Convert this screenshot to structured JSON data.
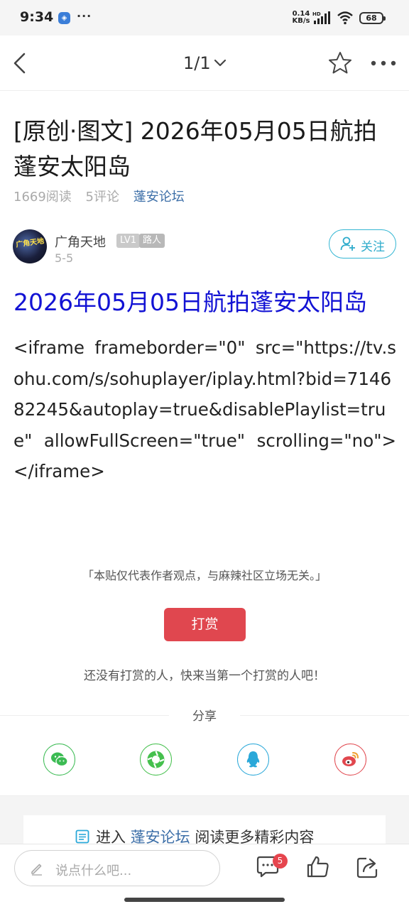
{
  "status_bar": {
    "time": "9:34",
    "app_icon_label": "",
    "more_dots": "···",
    "network_speed": "0.14\nKB/s",
    "network_speed_value": "0.14",
    "network_speed_unit": "KB/s",
    "hd_label": "HD",
    "battery_level": "68"
  },
  "nav": {
    "page_indicator": "1/1",
    "icons": [
      "back-arrow-icon",
      "chevron-down-icon",
      "star-icon",
      "more-horizontal-icon"
    ]
  },
  "post": {
    "title": "[原创·图文] 2026年05月05日航拍蓬安太阳岛",
    "reads": "1669阅读",
    "comments": "5评论",
    "forum": "蓬安论坛",
    "author": {
      "name": "广角天地",
      "level": "LV1",
      "role": "路人",
      "date": "5-5",
      "avatar_text": "广角天地"
    },
    "follow_label": "关注",
    "content_heading": "2026年05月05日航拍蓬安太阳岛",
    "content_body": "<iframe frameborder=\"0\" src=\"https://tv.sohu.com/s/sohuplayer/iplay.html?bid=714682245&autoplay=true&disablePlaylist=true\" allowFullScreen=\"true\" scrolling=\"no\"></iframe>",
    "disclaimer": "「本贴仅代表作者观点，与麻辣社区立场无关。」",
    "reward_label": "打赏",
    "reward_note": "还没有打赏的人，快来当第一个打赏的人吧！"
  },
  "share": {
    "label": "分享",
    "targets": [
      "wechat-icon",
      "moments-icon",
      "qq-icon",
      "weibo-icon"
    ]
  },
  "enter_forum": {
    "prefix": "进入",
    "forum": "蓬安论坛",
    "suffix": "阅读更多精彩内容"
  },
  "bottom_bar": {
    "placeholder": "说点什么吧...",
    "comment_count": "5"
  },
  "colors": {
    "accent_blue": "#3d6fa8",
    "heading_blue": "#1212d4",
    "follow_cyan": "#34b6d3",
    "reward_red": "#e0474f",
    "badge_red": "#e6454e"
  }
}
